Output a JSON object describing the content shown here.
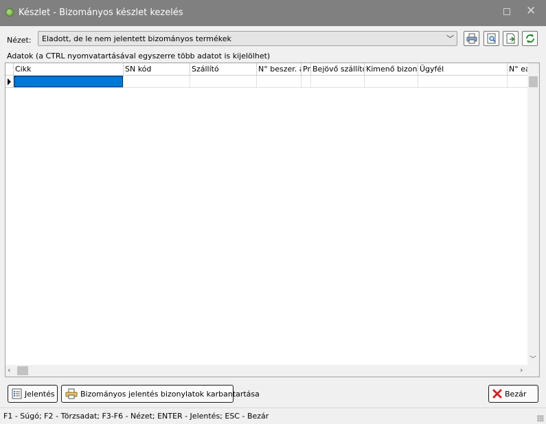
{
  "window": {
    "title": "Készlet - Bizományos készlet kezelés"
  },
  "view": {
    "label": "Nézet:",
    "selected": "Eladott, de le nem jelentett bizományos termékek"
  },
  "toolbar": {
    "icons": [
      "printer-icon",
      "print-preview-icon",
      "export-icon",
      "refresh-icon"
    ]
  },
  "data_section": {
    "label": "Adatok (a CTRL nyomvatartásával egyszerre több adatot is kijelölhet)"
  },
  "grid": {
    "columns": [
      "Cikk",
      "SN kód",
      "Szállító",
      "N° beszer. ár",
      "Pr",
      "Bejövő szállítólevél",
      "Kimenő bizonylat",
      "Ügyfél",
      "N° eár"
    ],
    "rows": [
      [
        "",
        "",
        "",
        "",
        "",
        "",
        "",
        "",
        ""
      ]
    ]
  },
  "buttons": {
    "report": "Jelentés",
    "maintenance": "Bizományos jelentés bizonylatok karbantartása",
    "close": "Bezár"
  },
  "status_bar": {
    "text": "F1 - Súgó; F2 - Törzsadat; F3-F6 - Nézet; ENTER - Jelentés; ESC - Bezár"
  }
}
